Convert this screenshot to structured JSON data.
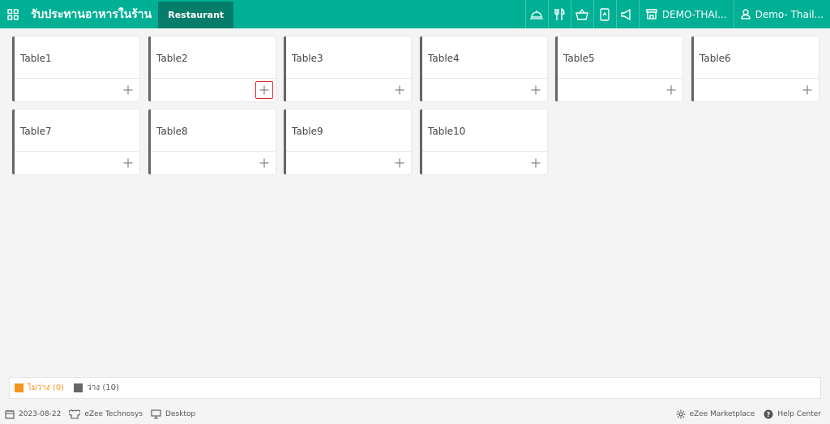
{
  "header": {
    "title": "รับประทานอาหารในร้าน",
    "active_tab": "Restaurant",
    "property": "DEMO-THAI...",
    "user": "Demo- Thail..."
  },
  "tables": [
    {
      "name": "Table1"
    },
    {
      "name": "Table2"
    },
    {
      "name": "Table3"
    },
    {
      "name": "Table4"
    },
    {
      "name": "Table5"
    },
    {
      "name": "Table6"
    },
    {
      "name": "Table7"
    },
    {
      "name": "Table8"
    },
    {
      "name": "Table9"
    },
    {
      "name": "Table10"
    }
  ],
  "legend": {
    "occupied": {
      "label": "ไม่ว่าง (0)",
      "color": "#f7941d"
    },
    "vacant": {
      "label": "ว่าง (10)",
      "color": "#666666"
    }
  },
  "footer": {
    "date": "2023-08-22",
    "company": "eZee Technosys",
    "device": "Desktop",
    "marketplace": "eZee Marketplace",
    "help": "Help Center"
  },
  "colors": {
    "brand": "#00b095",
    "tab_active": "#067d6a",
    "highlight": "#e0262e"
  },
  "icons": [
    "apps-grid-icon",
    "dish-icon",
    "fork-knife-icon",
    "basket-icon",
    "mobile-order-icon",
    "megaphone-icon",
    "store-icon",
    "user-icon",
    "calendar-icon",
    "chef-hat-icon",
    "monitor-icon",
    "gear-icon",
    "help-icon",
    "plus-icon"
  ]
}
